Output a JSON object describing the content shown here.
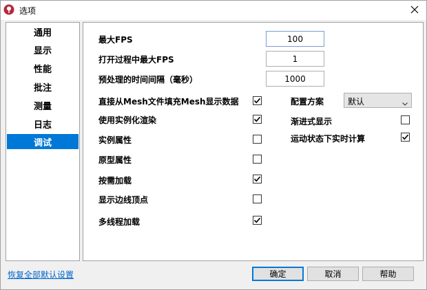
{
  "window": {
    "title": "选项",
    "app_icon": "app-logo-icon",
    "close_icon": "close-icon"
  },
  "sidebar": {
    "items": [
      {
        "label": "通用",
        "active": false
      },
      {
        "label": "显示",
        "active": false
      },
      {
        "label": "性能",
        "active": false
      },
      {
        "label": "批注",
        "active": false
      },
      {
        "label": "测量",
        "active": false
      },
      {
        "label": "日志",
        "active": false
      },
      {
        "label": "调试",
        "active": true
      }
    ]
  },
  "debug": {
    "max_fps": {
      "label": "最大FPS",
      "value": "100"
    },
    "open_max_fps": {
      "label": "打开过程中最大FPS",
      "value": "1"
    },
    "preprocess_interval": {
      "label": "预处理的时间间隔（毫秒）",
      "value": "1000"
    },
    "fill_from_mesh": {
      "label": "直接从Mesh文件填充Mesh显示数据",
      "checked": true
    },
    "use_instancing": {
      "label": "使用实例化渲染",
      "checked": true
    },
    "instance_props": {
      "label": "实例属性",
      "checked": false
    },
    "prototype_props": {
      "label": "原型属性",
      "checked": false
    },
    "load_on_demand": {
      "label": "按需加载",
      "checked": true
    },
    "show_edge_vertices": {
      "label": "显示边线顶点",
      "checked": false
    },
    "multithread_load": {
      "label": "多线程加载",
      "checked": true
    },
    "config_scheme": {
      "label": "配置方案",
      "value": "默认"
    },
    "progressive_display": {
      "label": "渐进式显示",
      "checked": false
    },
    "realtime_in_motion": {
      "label": "运动状态下实时计算",
      "checked": true
    }
  },
  "footer": {
    "reset_link": "恢复全部默认设置",
    "ok": "确定",
    "cancel": "取消",
    "help": "帮助"
  },
  "colors": {
    "accent": "#0078d7",
    "link": "#0066cc",
    "logo": "#b52a3a"
  }
}
